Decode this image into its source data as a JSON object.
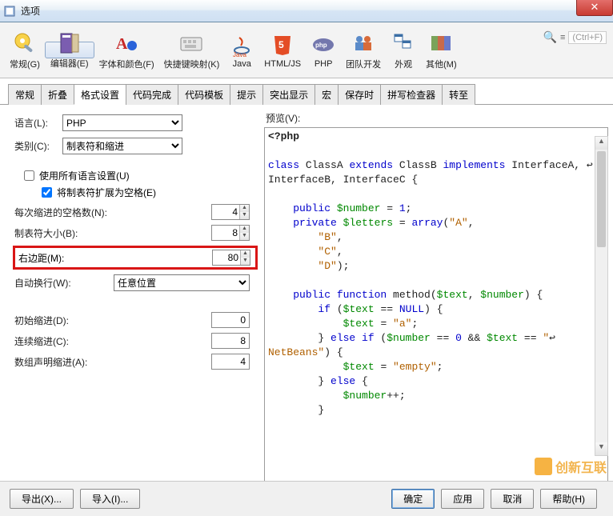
{
  "window": {
    "title": "选项"
  },
  "toolbar": {
    "items": [
      {
        "label": "常规(G)"
      },
      {
        "label": "编辑器(E)"
      },
      {
        "label": "字体和颜色(F)"
      },
      {
        "label": "快捷键映射(K)"
      },
      {
        "label": "Java"
      },
      {
        "label": "HTML/JS"
      },
      {
        "label": "PHP"
      },
      {
        "label": "团队开发"
      },
      {
        "label": "外观"
      },
      {
        "label": "其他(M)"
      }
    ],
    "search_hint": "(Ctrl+F)"
  },
  "subtabs": [
    "常规",
    "折叠",
    "格式设置",
    "代码完成",
    "代码模板",
    "提示",
    "突出显示",
    "宏",
    "保存时",
    "拼写检查器",
    "转至"
  ],
  "subtab_active": 2,
  "form": {
    "language_label": "语言(L):",
    "language_value": "PHP",
    "category_label": "类别(C):",
    "category_value": "制表符和缩进",
    "use_all_lang": "使用所有语言设置(U)",
    "expand_tabs": "将制表符扩展为空格(E)",
    "spaces_per_indent_label": "每次缩进的空格数(N):",
    "spaces_per_indent_value": "4",
    "tab_size_label": "制表符大小(B):",
    "tab_size_value": "8",
    "right_margin_label": "右边距(M):",
    "right_margin_value": "80",
    "line_wrap_label": "自动换行(W):",
    "line_wrap_value": "任意位置",
    "initial_indent_label": "初始缩进(D):",
    "initial_indent_value": "0",
    "continuation_indent_label": "连续缩进(C):",
    "continuation_indent_value": "8",
    "array_decl_indent_label": "数组声明缩进(A):",
    "array_decl_indent_value": "4"
  },
  "preview": {
    "label": "预览(V):",
    "lines": [
      "<?php",
      "",
      "class ClassA extends ClassB implements InterfaceA, ↩",
      "InterfaceB, InterfaceC {",
      "",
      "    public $number = 1;",
      "    private $letters = array(\"A\",",
      "        \"B\",",
      "        \"C\",",
      "        \"D\");",
      "",
      "    public function method($text, $number) {",
      "        if ($text == NULL) {",
      "            $text = \"a\";",
      "        } else if ($number == 0 && $text == \"↩",
      "NetBeans\") {",
      "            $text = \"empty\";",
      "        } else {",
      "            $number++;",
      "        }"
    ]
  },
  "footer": {
    "export": "导出(X)...",
    "import": "导入(I)...",
    "ok": "确定",
    "apply": "应用",
    "cancel": "取消",
    "help": "帮助(H)"
  },
  "watermark": "创新互联"
}
